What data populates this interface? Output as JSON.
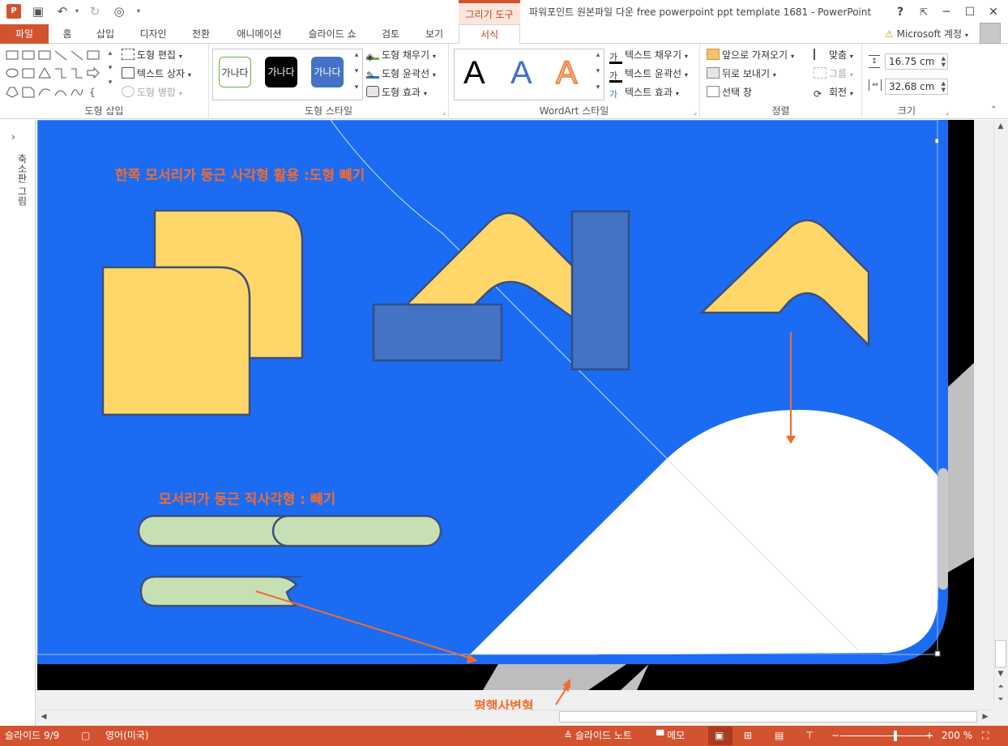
{
  "titlebar": {
    "contextual_tab": "그리기 도구",
    "window_title": "파워포인트 원본파일 다운 free powerpoint ppt template 1681 - PowerPoint",
    "help": "?",
    "minimize": "─",
    "restore": "☐",
    "close": "✕"
  },
  "tabs": [
    {
      "label": "파일"
    },
    {
      "label": "홈"
    },
    {
      "label": "삽입"
    },
    {
      "label": "디자인"
    },
    {
      "label": "전환"
    },
    {
      "label": "애니메이션"
    },
    {
      "label": "슬라이드 쇼"
    },
    {
      "label": "검토"
    },
    {
      "label": "보기"
    },
    {
      "label": "서식"
    }
  ],
  "account": {
    "label": "Microsoft 계정"
  },
  "ribbon": {
    "insert_shapes": {
      "group_label": "도형 삽입",
      "edit_shape": "도형 편집",
      "text_box": "텍스트 상자",
      "merge_shapes": "도형 병합"
    },
    "shape_styles": {
      "group_label": "도형 스타일",
      "swatch_text": "가나다",
      "fill": "도형 채우기",
      "outline": "도형 윤곽선",
      "effects": "도형 효과"
    },
    "wordart": {
      "group_label": "WordArt 스타일",
      "letter": "A",
      "text_fill": "텍스트 채우기",
      "text_outline": "텍스트 윤곽선",
      "text_effects": "텍스트 효과"
    },
    "arrange": {
      "group_label": "정렬",
      "bring_forward": "앞으로 가져오기",
      "send_backward": "뒤로 보내기",
      "selection_pane": "선택 창",
      "align": "맞춤",
      "group": "그룹",
      "rotate": "회전"
    },
    "size": {
      "group_label": "크기",
      "height": "16.75 cm",
      "width": "32.68 cm"
    }
  },
  "thumbnail_pane": {
    "label": "축소판 그림",
    "expand": "›"
  },
  "slide": {
    "heading_one": "한쪽 모서리가 둥근 사각형 활용 :도형 빼기",
    "heading_two": "모서리가 둥근 직사각형 : 빼기",
    "label_parallelogram": "평행사변형"
  },
  "statusbar": {
    "slide_count": "슬라이드 9/9",
    "language": "영어(미국)",
    "notes": "슬라이드 노트",
    "comments": "메모",
    "zoom": "200 %",
    "zoom_minus": "−",
    "zoom_plus": "+",
    "zoom_level_percent": 60
  },
  "colors": {
    "accent": "#d35230",
    "slide_blue": "#1b6cf2",
    "yellow": "#ffd769",
    "dark_blue_shape": "#4472c4",
    "green_pill": "#c6e0b4",
    "orange_text": "#f26b2e",
    "white_band": "#ffffff",
    "gray_shadow": "#c0c0c0"
  }
}
